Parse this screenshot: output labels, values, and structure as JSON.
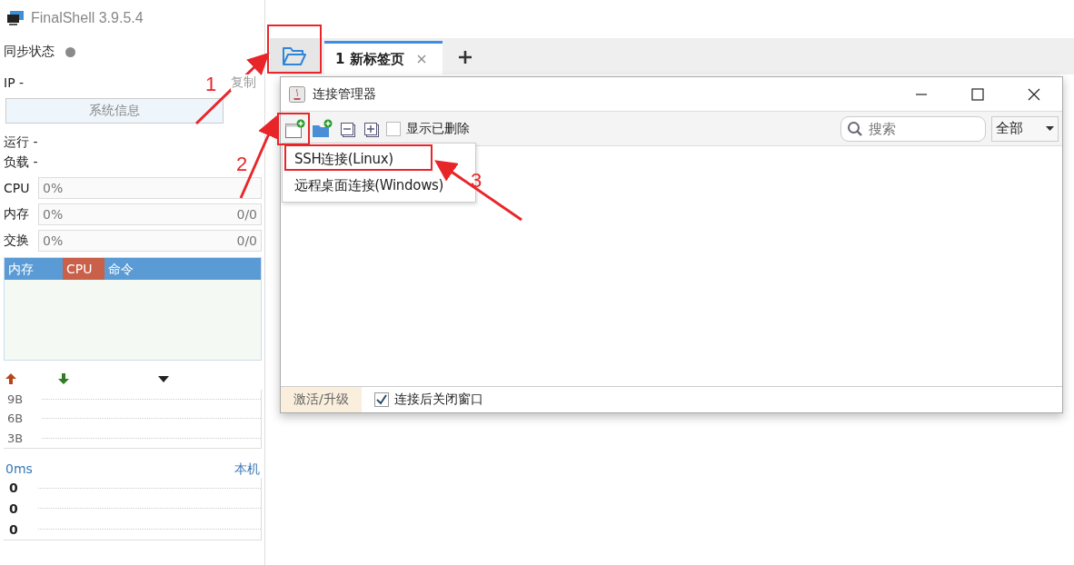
{
  "app": {
    "title": "FinalShell 3.9.5.4"
  },
  "sidebar": {
    "sync_status": {
      "label": "同步状态",
      "online": false
    },
    "ip": {
      "label": "IP",
      "value": "-",
      "copy": "复制"
    },
    "system_info_button": "系统信息",
    "runtime": "运行 -",
    "load": "负载 -",
    "meters": [
      {
        "label": "CPU",
        "reading": "0%",
        "level": 0
      },
      {
        "label": "内存",
        "reading": "0%",
        "usage": "0/0",
        "level": 0
      },
      {
        "label": "交换",
        "reading": "0%",
        "usage": "0/0",
        "level": 0
      }
    ],
    "process_tabs": [
      {
        "label": "内存",
        "selected": false
      },
      {
        "label": "CPU",
        "selected": true
      },
      {
        "label": "命令",
        "selected": false
      }
    ],
    "network": {
      "y_labels": [
        "9B",
        "6B",
        "3B"
      ]
    },
    "ping": {
      "latency": "0ms",
      "host": "本机",
      "values": [
        "0",
        "0",
        "0"
      ]
    }
  },
  "tabs": [
    {
      "label": "1 新标签页",
      "selected": true
    }
  ],
  "dialog": {
    "title": "连接管理器",
    "show_deleted": {
      "label": "显示已删除",
      "checked": false
    },
    "search": {
      "placeholder": "搜索"
    },
    "filter": "全部",
    "new_menu": [
      "SSH连接(Linux)",
      "远程桌面连接(Windows)"
    ],
    "activate": "激活/升级",
    "close_after_connect": {
      "label": "连接后关闭窗口",
      "checked": true
    }
  },
  "annotations": [
    {
      "label": "1"
    },
    {
      "label": "2"
    },
    {
      "label": "3"
    }
  ]
}
